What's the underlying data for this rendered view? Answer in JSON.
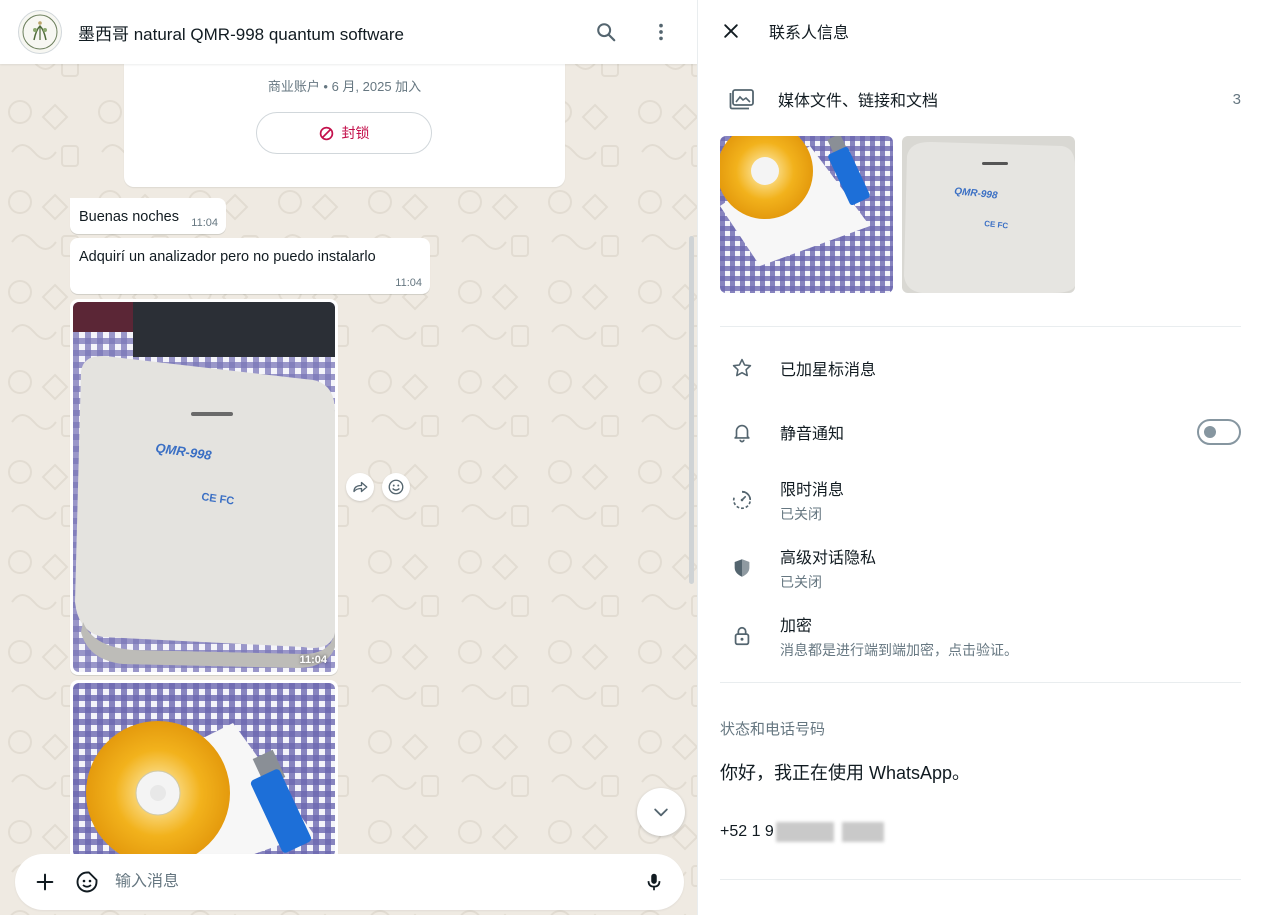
{
  "chat": {
    "title": "墨西哥 natural QMR-998 quantum software",
    "business_card": {
      "subtitle": "商业账户 • 6 月, 2025 加入",
      "block_label": "封锁"
    },
    "messages": [
      {
        "text": "Buenas noches",
        "time": "11:04"
      },
      {
        "text": "Adquirí un analizador pero no puedo instalarlo",
        "time": "11:04"
      }
    ],
    "image_message_time": "11:04",
    "composer": {
      "placeholder": "输入消息"
    }
  },
  "contact_info": {
    "title": "联系人信息",
    "media": {
      "label": "媒体文件、链接和文档",
      "count": "3"
    },
    "starred": {
      "label": "已加星标消息"
    },
    "mute": {
      "label": "静音通知",
      "enabled": false
    },
    "disappearing": {
      "label": "限时消息",
      "sub": "已关闭"
    },
    "privacy": {
      "label": "高级对话隐私",
      "sub": "已关闭"
    },
    "encryption": {
      "label": "加密",
      "sub": "消息都是进行端到端加密，点击验证。"
    },
    "status_section": {
      "title": "状态和电话号码",
      "status": "你好，我正在使用 WhatsApp。",
      "phone_visible": "+52 1 9"
    }
  },
  "colors": {
    "block_red": "#c3104b",
    "chat_bg": "#efeae2",
    "secondary_text": "#667781"
  }
}
